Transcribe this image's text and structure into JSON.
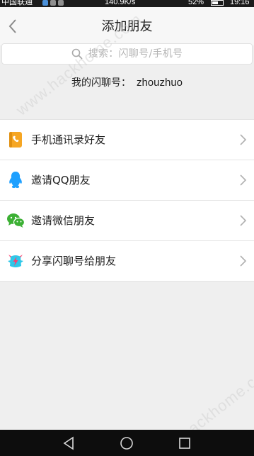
{
  "status_bar": {
    "carrier": "中国联通",
    "network_speed": "140.9K/s",
    "battery_percent": "52%",
    "time": "19:16"
  },
  "header": {
    "back_icon": "chevron-left-icon",
    "title": "添加朋友"
  },
  "search": {
    "icon": "search-icon",
    "placeholder": "搜索：闪聊号/手机号"
  },
  "my_id": {
    "label": "我的闪聊号：",
    "value": "zhouzhuo"
  },
  "menu": {
    "items": [
      {
        "label": "手机通讯录好友",
        "icon": "contacts-book-icon",
        "color": "#f6a623"
      },
      {
        "label": "邀请QQ朋友",
        "icon": "qq-penguin-icon",
        "color": "#1ea0ff"
      },
      {
        "label": "邀请微信朋友",
        "icon": "wechat-icon",
        "color": "#3cb034"
      },
      {
        "label": "分享闪聊号给朋友",
        "icon": "flash-chat-logo-icon",
        "color": "#2fc7e8"
      }
    ]
  },
  "watermark": "www.hackhome.com",
  "nav_bar": {
    "back_icon": "triangle-back-icon",
    "home_icon": "circle-home-icon",
    "recent_icon": "square-recent-icon"
  }
}
